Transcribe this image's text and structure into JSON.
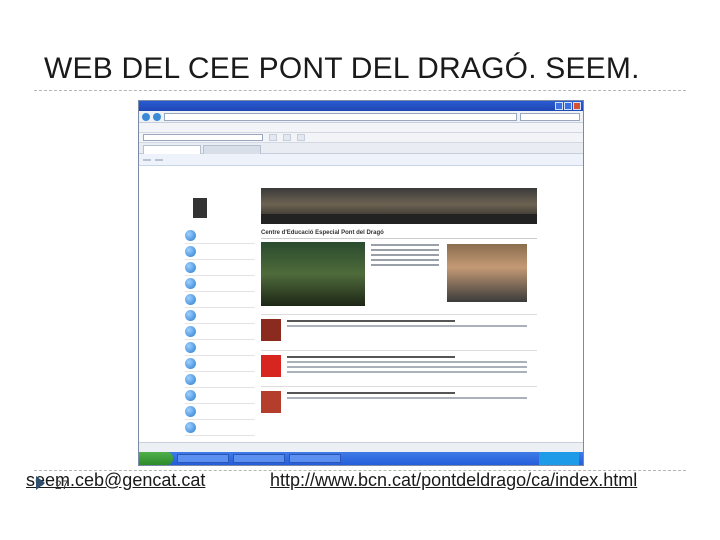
{
  "slide": {
    "title": "WEB DEL CEE PONT DEL DRAGÓ. SEEM.",
    "email": "seem.ceb@gencat.cat",
    "url": "http://www.bcn.cat/pontdeldrago/ca/index.html",
    "page_number": "27"
  },
  "screenshot": {
    "site_title": "Centre d'Educació Especial Pont del Dragó"
  },
  "colors": {
    "window_titlebar": "#245edb",
    "taskbar": "#245edb",
    "start_button": "#3a9a35"
  },
  "icons": [
    "play-bullet-icon",
    "window-minimize-icon",
    "window-close-icon",
    "nav-orb-icon"
  ]
}
